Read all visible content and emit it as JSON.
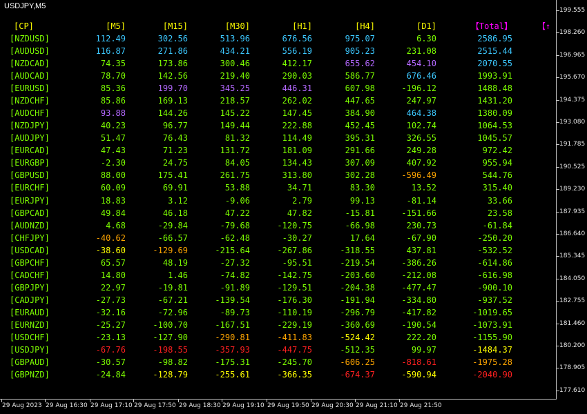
{
  "window": {
    "symbol_label": "USDJPY,M5"
  },
  "colors": {
    "header": "#ffff00",
    "total_header": "#ff00ff",
    "pair": "#7cfc00",
    "cyan": "#3cc8ff",
    "green": "#7cfc00",
    "violet": "#b469ff",
    "yellow": "#ffff00",
    "orange": "#ffa500",
    "red": "#ff2020"
  },
  "table": {
    "headers": [
      "[CP]",
      "[M5]",
      "[M15]",
      "[M30]",
      "[H1]",
      "[H4]",
      "[D1]",
      "【Total】",
      "【↑"
    ],
    "rows": [
      {
        "pair": "[NZDUSD]",
        "cells": [
          {
            "v": "112.49",
            "c": "cyan"
          },
          {
            "v": "302.56",
            "c": "cyan"
          },
          {
            "v": "513.96",
            "c": "cyan"
          },
          {
            "v": "676.56",
            "c": "cyan"
          },
          {
            "v": "975.07",
            "c": "cyan"
          },
          {
            "v": "6.30",
            "c": "green"
          },
          {
            "v": "2586.95",
            "c": "cyan"
          }
        ]
      },
      {
        "pair": "[AUDUSD]",
        "cells": [
          {
            "v": "116.87",
            "c": "cyan"
          },
          {
            "v": "271.86",
            "c": "cyan"
          },
          {
            "v": "434.21",
            "c": "cyan"
          },
          {
            "v": "556.19",
            "c": "cyan"
          },
          {
            "v": "905.23",
            "c": "cyan"
          },
          {
            "v": "231.08",
            "c": "green"
          },
          {
            "v": "2515.44",
            "c": "cyan"
          }
        ]
      },
      {
        "pair": "[NZDCAD]",
        "cells": [
          {
            "v": "74.35",
            "c": "green"
          },
          {
            "v": "173.86",
            "c": "green"
          },
          {
            "v": "300.46",
            "c": "green"
          },
          {
            "v": "412.17",
            "c": "green"
          },
          {
            "v": "655.62",
            "c": "violet"
          },
          {
            "v": "454.10",
            "c": "violet"
          },
          {
            "v": "2070.55",
            "c": "cyan"
          }
        ]
      },
      {
        "pair": "[AUDCAD]",
        "cells": [
          {
            "v": "78.70",
            "c": "green"
          },
          {
            "v": "142.56",
            "c": "green"
          },
          {
            "v": "219.40",
            "c": "green"
          },
          {
            "v": "290.03",
            "c": "green"
          },
          {
            "v": "586.77",
            "c": "green"
          },
          {
            "v": "676.46",
            "c": "cyan"
          },
          {
            "v": "1993.91",
            "c": "green"
          }
        ]
      },
      {
        "pair": "[EURUSD]",
        "cells": [
          {
            "v": "85.36",
            "c": "green"
          },
          {
            "v": "199.70",
            "c": "violet"
          },
          {
            "v": "345.25",
            "c": "violet"
          },
          {
            "v": "446.31",
            "c": "violet"
          },
          {
            "v": "607.98",
            "c": "green"
          },
          {
            "v": "-196.12",
            "c": "green"
          },
          {
            "v": "1488.48",
            "c": "green"
          }
        ]
      },
      {
        "pair": "[NZDCHF]",
        "cells": [
          {
            "v": "85.86",
            "c": "green"
          },
          {
            "v": "169.13",
            "c": "green"
          },
          {
            "v": "218.57",
            "c": "green"
          },
          {
            "v": "262.02",
            "c": "green"
          },
          {
            "v": "447.65",
            "c": "green"
          },
          {
            "v": "247.97",
            "c": "green"
          },
          {
            "v": "1431.20",
            "c": "green"
          }
        ]
      },
      {
        "pair": "[AUDCHF]",
        "cells": [
          {
            "v": "93.88",
            "c": "violet"
          },
          {
            "v": "144.26",
            "c": "green"
          },
          {
            "v": "145.22",
            "c": "green"
          },
          {
            "v": "147.45",
            "c": "green"
          },
          {
            "v": "384.90",
            "c": "green"
          },
          {
            "v": "464.38",
            "c": "cyan"
          },
          {
            "v": "1380.09",
            "c": "green"
          }
        ]
      },
      {
        "pair": "[NZDJPY]",
        "cells": [
          {
            "v": "40.23",
            "c": "green"
          },
          {
            "v": "96.77",
            "c": "green"
          },
          {
            "v": "149.44",
            "c": "green"
          },
          {
            "v": "222.88",
            "c": "green"
          },
          {
            "v": "452.45",
            "c": "green"
          },
          {
            "v": "102.74",
            "c": "green"
          },
          {
            "v": "1064.53",
            "c": "green"
          }
        ]
      },
      {
        "pair": "[AUDJPY]",
        "cells": [
          {
            "v": "51.47",
            "c": "green"
          },
          {
            "v": "76.43",
            "c": "green"
          },
          {
            "v": "81.32",
            "c": "green"
          },
          {
            "v": "114.49",
            "c": "green"
          },
          {
            "v": "395.31",
            "c": "green"
          },
          {
            "v": "326.55",
            "c": "green"
          },
          {
            "v": "1045.57",
            "c": "green"
          }
        ]
      },
      {
        "pair": "[EURCAD]",
        "cells": [
          {
            "v": "47.43",
            "c": "green"
          },
          {
            "v": "71.23",
            "c": "green"
          },
          {
            "v": "131.72",
            "c": "green"
          },
          {
            "v": "181.09",
            "c": "green"
          },
          {
            "v": "291.66",
            "c": "green"
          },
          {
            "v": "249.28",
            "c": "green"
          },
          {
            "v": "972.42",
            "c": "green"
          }
        ]
      },
      {
        "pair": "[EURGBP]",
        "cells": [
          {
            "v": "-2.30",
            "c": "green"
          },
          {
            "v": "24.75",
            "c": "green"
          },
          {
            "v": "84.05",
            "c": "green"
          },
          {
            "v": "134.43",
            "c": "green"
          },
          {
            "v": "307.09",
            "c": "green"
          },
          {
            "v": "407.92",
            "c": "green"
          },
          {
            "v": "955.94",
            "c": "green"
          }
        ]
      },
      {
        "pair": "[GBPUSD]",
        "cells": [
          {
            "v": "88.00",
            "c": "green"
          },
          {
            "v": "175.41",
            "c": "green"
          },
          {
            "v": "261.75",
            "c": "green"
          },
          {
            "v": "313.80",
            "c": "green"
          },
          {
            "v": "302.28",
            "c": "green"
          },
          {
            "v": "-596.49",
            "c": "orange"
          },
          {
            "v": "544.76",
            "c": "green"
          }
        ]
      },
      {
        "pair": "[EURCHF]",
        "cells": [
          {
            "v": "60.09",
            "c": "green"
          },
          {
            "v": "69.91",
            "c": "green"
          },
          {
            "v": "53.88",
            "c": "green"
          },
          {
            "v": "34.71",
            "c": "green"
          },
          {
            "v": "83.30",
            "c": "green"
          },
          {
            "v": "13.52",
            "c": "green"
          },
          {
            "v": "315.40",
            "c": "green"
          }
        ]
      },
      {
        "pair": "[EURJPY]",
        "cells": [
          {
            "v": "18.83",
            "c": "green"
          },
          {
            "v": "3.12",
            "c": "green"
          },
          {
            "v": "-9.06",
            "c": "green"
          },
          {
            "v": "2.79",
            "c": "green"
          },
          {
            "v": "99.13",
            "c": "green"
          },
          {
            "v": "-81.14",
            "c": "green"
          },
          {
            "v": "33.66",
            "c": "green"
          }
        ]
      },
      {
        "pair": "[GBPCAD]",
        "cells": [
          {
            "v": "49.84",
            "c": "green"
          },
          {
            "v": "46.18",
            "c": "green"
          },
          {
            "v": "47.22",
            "c": "green"
          },
          {
            "v": "47.82",
            "c": "green"
          },
          {
            "v": "-15.81",
            "c": "green"
          },
          {
            "v": "-151.66",
            "c": "green"
          },
          {
            "v": "23.58",
            "c": "green"
          }
        ]
      },
      {
        "pair": "[AUDNZD]",
        "cells": [
          {
            "v": "4.68",
            "c": "green"
          },
          {
            "v": "-29.84",
            "c": "green"
          },
          {
            "v": "-79.68",
            "c": "green"
          },
          {
            "v": "-120.75",
            "c": "green"
          },
          {
            "v": "-66.98",
            "c": "green"
          },
          {
            "v": "230.73",
            "c": "green"
          },
          {
            "v": "-61.84",
            "c": "green"
          }
        ]
      },
      {
        "pair": "[CHFJPY]",
        "cells": [
          {
            "v": "-40.62",
            "c": "orange"
          },
          {
            "v": "-66.57",
            "c": "green"
          },
          {
            "v": "-62.48",
            "c": "green"
          },
          {
            "v": "-30.27",
            "c": "green"
          },
          {
            "v": "17.64",
            "c": "green"
          },
          {
            "v": "-67.90",
            "c": "green"
          },
          {
            "v": "-250.20",
            "c": "green"
          }
        ]
      },
      {
        "pair": "[USDCAD]",
        "cells": [
          {
            "v": "-38.60",
            "c": "yellow"
          },
          {
            "v": "-129.69",
            "c": "orange"
          },
          {
            "v": "-215.64",
            "c": "green"
          },
          {
            "v": "-267.86",
            "c": "green"
          },
          {
            "v": "-318.55",
            "c": "green"
          },
          {
            "v": "437.81",
            "c": "green"
          },
          {
            "v": "-532.52",
            "c": "green"
          }
        ]
      },
      {
        "pair": "[GBPCHF]",
        "cells": [
          {
            "v": "65.57",
            "c": "green"
          },
          {
            "v": "48.19",
            "c": "green"
          },
          {
            "v": "-27.32",
            "c": "green"
          },
          {
            "v": "-95.51",
            "c": "green"
          },
          {
            "v": "-219.54",
            "c": "green"
          },
          {
            "v": "-386.26",
            "c": "green"
          },
          {
            "v": "-614.86",
            "c": "green"
          }
        ]
      },
      {
        "pair": "[CADCHF]",
        "cells": [
          {
            "v": "14.80",
            "c": "green"
          },
          {
            "v": "1.46",
            "c": "green"
          },
          {
            "v": "-74.82",
            "c": "green"
          },
          {
            "v": "-142.75",
            "c": "green"
          },
          {
            "v": "-203.60",
            "c": "green"
          },
          {
            "v": "-212.08",
            "c": "green"
          },
          {
            "v": "-616.98",
            "c": "green"
          }
        ]
      },
      {
        "pair": "[GBPJPY]",
        "cells": [
          {
            "v": "22.97",
            "c": "green"
          },
          {
            "v": "-19.81",
            "c": "green"
          },
          {
            "v": "-91.89",
            "c": "green"
          },
          {
            "v": "-129.51",
            "c": "green"
          },
          {
            "v": "-204.38",
            "c": "green"
          },
          {
            "v": "-477.47",
            "c": "green"
          },
          {
            "v": "-900.10",
            "c": "green"
          }
        ]
      },
      {
        "pair": "[CADJPY]",
        "cells": [
          {
            "v": "-27.73",
            "c": "green"
          },
          {
            "v": "-67.21",
            "c": "green"
          },
          {
            "v": "-139.54",
            "c": "green"
          },
          {
            "v": "-176.30",
            "c": "green"
          },
          {
            "v": "-191.94",
            "c": "green"
          },
          {
            "v": "-334.80",
            "c": "green"
          },
          {
            "v": "-937.52",
            "c": "green"
          }
        ]
      },
      {
        "pair": "[EURAUD]",
        "cells": [
          {
            "v": "-32.16",
            "c": "green"
          },
          {
            "v": "-72.96",
            "c": "green"
          },
          {
            "v": "-89.73",
            "c": "green"
          },
          {
            "v": "-110.19",
            "c": "green"
          },
          {
            "v": "-296.79",
            "c": "green"
          },
          {
            "v": "-417.82",
            "c": "green"
          },
          {
            "v": "-1019.65",
            "c": "green"
          }
        ]
      },
      {
        "pair": "[EURNZD]",
        "cells": [
          {
            "v": "-25.27",
            "c": "green"
          },
          {
            "v": "-100.70",
            "c": "green"
          },
          {
            "v": "-167.51",
            "c": "green"
          },
          {
            "v": "-229.19",
            "c": "green"
          },
          {
            "v": "-360.69",
            "c": "green"
          },
          {
            "v": "-190.54",
            "c": "green"
          },
          {
            "v": "-1073.91",
            "c": "green"
          }
        ]
      },
      {
        "pair": "[USDCHF]",
        "cells": [
          {
            "v": "-23.13",
            "c": "green"
          },
          {
            "v": "-127.90",
            "c": "green"
          },
          {
            "v": "-290.81",
            "c": "orange"
          },
          {
            "v": "-411.83",
            "c": "orange"
          },
          {
            "v": "-524.42",
            "c": "yellow"
          },
          {
            "v": "222.20",
            "c": "green"
          },
          {
            "v": "-1155.90",
            "c": "green"
          }
        ]
      },
      {
        "pair": "[USDJPY]",
        "cells": [
          {
            "v": "-67.76",
            "c": "red"
          },
          {
            "v": "-198.55",
            "c": "red"
          },
          {
            "v": "-357.93",
            "c": "red"
          },
          {
            "v": "-447.75",
            "c": "red"
          },
          {
            "v": "-512.35",
            "c": "green"
          },
          {
            "v": "99.97",
            "c": "green"
          },
          {
            "v": "-1484.37",
            "c": "yellow"
          }
        ]
      },
      {
        "pair": "[GBPAUD]",
        "cells": [
          {
            "v": "-30.57",
            "c": "green"
          },
          {
            "v": "-98.82",
            "c": "green"
          },
          {
            "v": "-175.31",
            "c": "green"
          },
          {
            "v": "-245.70",
            "c": "green"
          },
          {
            "v": "-606.25",
            "c": "orange"
          },
          {
            "v": "-818.61",
            "c": "red"
          },
          {
            "v": "-1975.28",
            "c": "orange"
          }
        ]
      },
      {
        "pair": "[GBPNZD]",
        "cells": [
          {
            "v": "-24.84",
            "c": "green"
          },
          {
            "v": "-128.79",
            "c": "yellow"
          },
          {
            "v": "-255.61",
            "c": "yellow"
          },
          {
            "v": "-366.35",
            "c": "yellow"
          },
          {
            "v": "-674.37",
            "c": "red"
          },
          {
            "v": "-590.94",
            "c": "yellow"
          },
          {
            "v": "-2040.90",
            "c": "red"
          }
        ]
      }
    ]
  },
  "price_axis": [
    "199.555",
    "198.260",
    "196.965",
    "195.670",
    "194.375",
    "193.080",
    "191.785",
    "190.525",
    "189.230",
    "187.935",
    "186.640",
    "185.345",
    "184.050",
    "182.755",
    "181.460",
    "180.200",
    "178.905",
    "177.610"
  ],
  "time_axis": [
    "29 Aug 2023",
    "29 Aug 16:30",
    "29 Aug 17:10",
    "29 Aug 17:50",
    "29 Aug 18:30",
    "29 Aug 19:10",
    "29 Aug 19:50",
    "29 Aug 20:30",
    "29 Aug 21:10",
    "29 Aug 21:50"
  ]
}
